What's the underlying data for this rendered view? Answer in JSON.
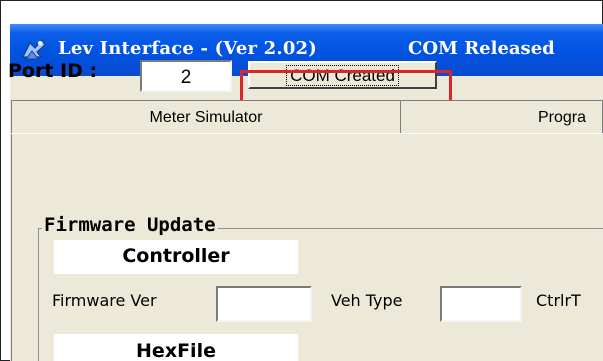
{
  "window": {
    "title": "Lev Interface - (Ver 2.02)",
    "status": "COM Released",
    "icon": "lev-app-icon"
  },
  "port": {
    "label": "Port ID :",
    "value": "2",
    "button_label": "COM Created"
  },
  "tabs": [
    {
      "label": "Meter Simulator"
    },
    {
      "label": "Progra"
    }
  ],
  "firmware_update": {
    "group_title": "Firmware Update",
    "controller_label": "Controller",
    "firmware_ver_label": "Firmware Ver",
    "firmware_ver_value": "",
    "veh_type_label": "Veh Type",
    "veh_type_value": "",
    "ctrlr_label": "CtrlrT",
    "hexfile_label": "HexFile"
  },
  "colors": {
    "titlebar": "#0053e1",
    "window_bg": "#ece9d8",
    "highlight": "#d9262b"
  }
}
